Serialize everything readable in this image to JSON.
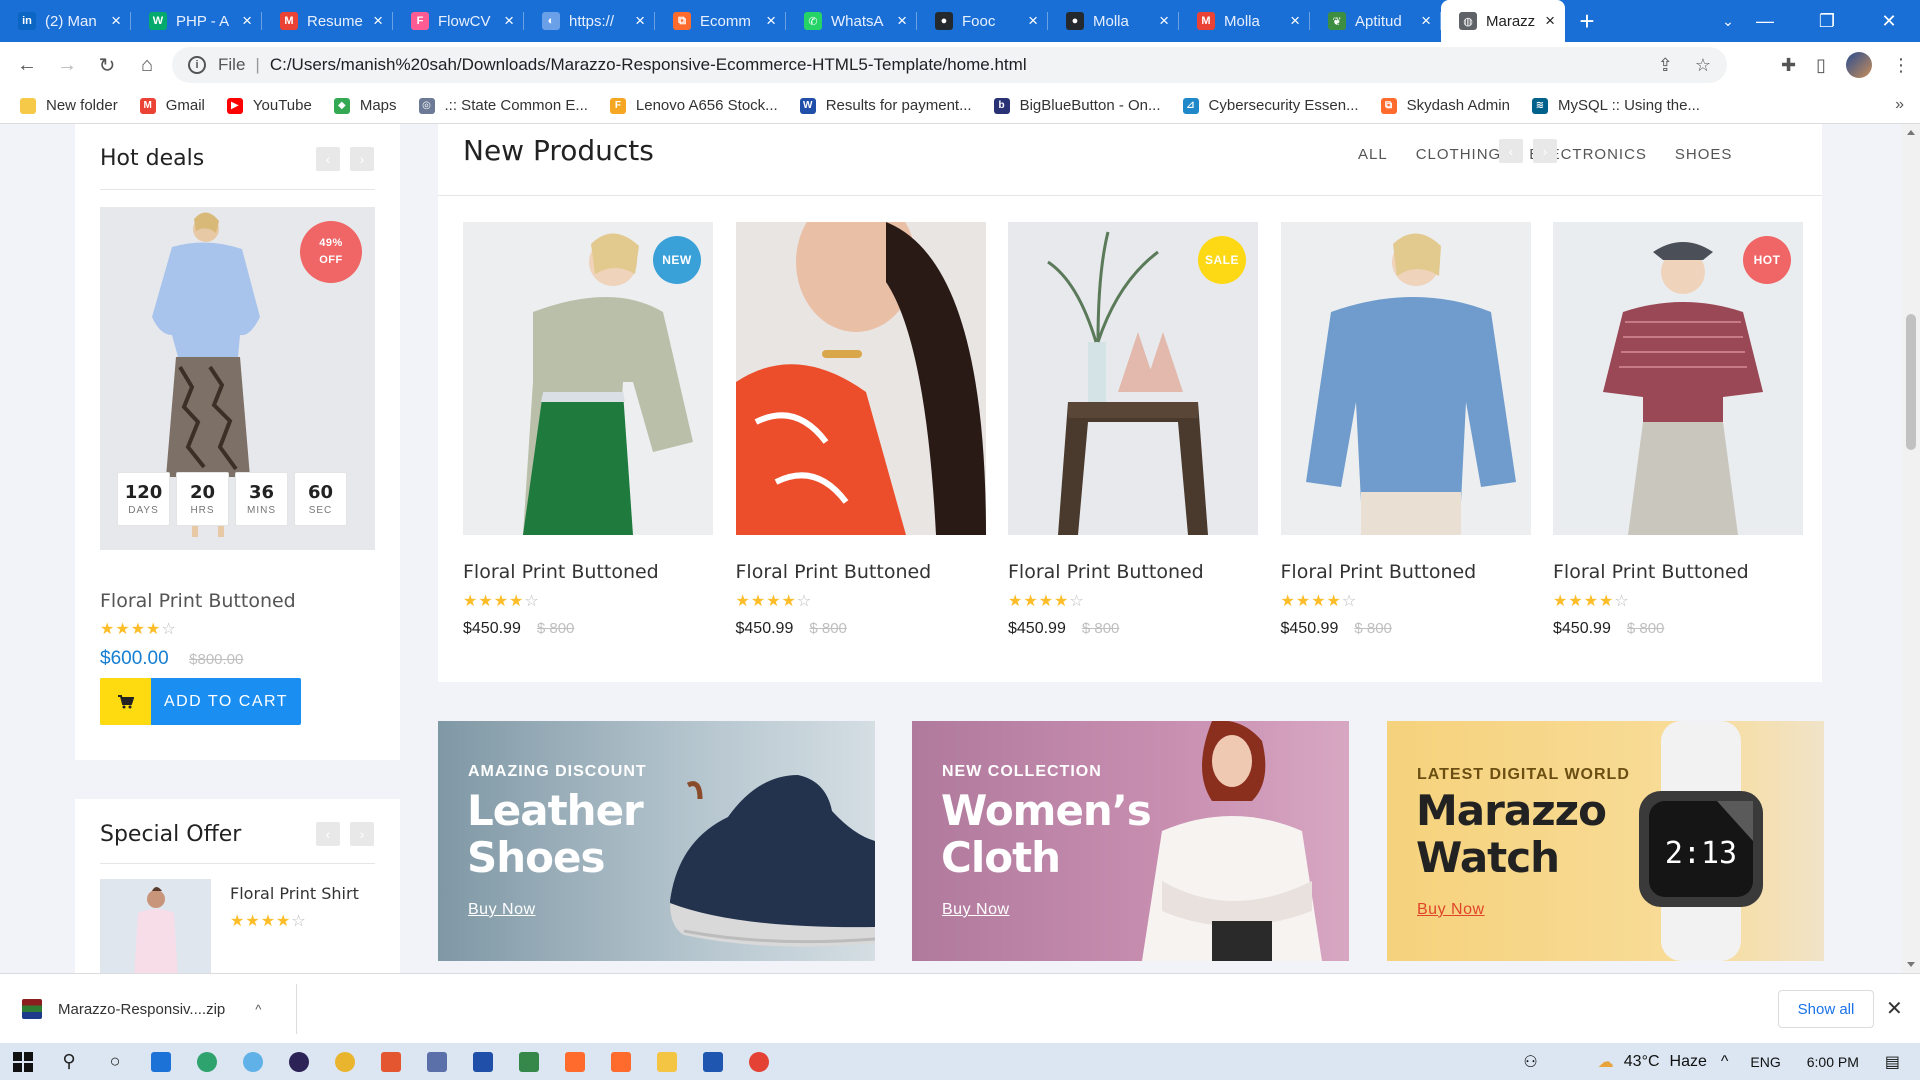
{
  "browser": {
    "tabs": [
      {
        "title": "(2) Man",
        "icon": "linkedin-icon",
        "color": "#0a66c2",
        "glyph": "in"
      },
      {
        "title": "PHP - A",
        "icon": "w3schools-icon",
        "color": "#04aa6d",
        "glyph": "W"
      },
      {
        "title": "Resume",
        "icon": "gmail-icon",
        "color": "#ea4335",
        "glyph": "M"
      },
      {
        "title": "FlowCV",
        "icon": "flowcv-icon",
        "color": "#ff5c93",
        "glyph": "F"
      },
      {
        "title": "https://",
        "icon": "globe-icon",
        "color": "#6aa0e8",
        "glyph": "◐"
      },
      {
        "title": "Ecomm",
        "icon": "app-icon",
        "color": "#ff6b2c",
        "glyph": "⧉"
      },
      {
        "title": "WhatsA",
        "icon": "whatsapp-icon",
        "color": "#25d366",
        "glyph": "✆"
      },
      {
        "title": "Fooc",
        "icon": "github-icon",
        "color": "#24292e",
        "glyph": "●"
      },
      {
        "title": "Molla",
        "icon": "github-icon",
        "color": "#24292e",
        "glyph": "●"
      },
      {
        "title": "Molla",
        "icon": "gmail-icon",
        "color": "#ea4335",
        "glyph": "M"
      },
      {
        "title": "Aptitud",
        "icon": "indiabix-icon",
        "color": "#3e8e41",
        "glyph": "❦"
      },
      {
        "title": "Marazz",
        "icon": "globe-icon",
        "color": "#5f6368",
        "glyph": "◍"
      }
    ],
    "url_scheme": "File",
    "url": "C:/Users/manish%20sah/Downloads/Marazzo-Responsive-Ecommerce-HTML5-Template/home.html",
    "bookmarks": [
      {
        "label": "New folder",
        "icon": "folder-icon",
        "color": "#f7c948",
        "glyph": ""
      },
      {
        "label": "Gmail",
        "icon": "gmail-icon",
        "color": "#ea4335",
        "glyph": "M"
      },
      {
        "label": "YouTube",
        "icon": "youtube-icon",
        "color": "#ff0000",
        "glyph": "▶"
      },
      {
        "label": "Maps",
        "icon": "maps-icon",
        "color": "#34a853",
        "glyph": "◆"
      },
      {
        "label": ".:: State Common E...",
        "icon": "globe-icon",
        "color": "#6c7a96",
        "glyph": "◎"
      },
      {
        "label": "Lenovo A656 Stock...",
        "icon": "f-icon",
        "color": "#f5a623",
        "glyph": "F"
      },
      {
        "label": "Results for payment...",
        "icon": "word-icon",
        "color": "#1f4fa8",
        "glyph": "W"
      },
      {
        "label": "BigBlueButton - On...",
        "icon": "bigbluebutton-icon",
        "color": "#283274",
        "glyph": "b"
      },
      {
        "label": "Cybersecurity Essen...",
        "icon": "cisco-icon",
        "color": "#1e88c9",
        "glyph": "⊿"
      },
      {
        "label": "Skydash Admin",
        "icon": "app-icon",
        "color": "#ff6b2c",
        "glyph": "⧉"
      },
      {
        "label": "MySQL :: Using the...",
        "icon": "mysql-icon",
        "color": "#00618a",
        "glyph": "≋"
      }
    ]
  },
  "sidebar": {
    "hot_deals": {
      "title": "Hot deals",
      "badge_pct": "49%",
      "badge_off": "OFF",
      "countdown": [
        {
          "value": "120",
          "unit": "DAYS"
        },
        {
          "value": "20",
          "unit": "HRS"
        },
        {
          "value": "36",
          "unit": "MINS"
        },
        {
          "value": "60",
          "unit": "SEC"
        }
      ],
      "product_name": "Floral Print Buttoned",
      "rating": 4,
      "price": "$600.00",
      "old_price": "$800.00",
      "cart_label": "ADD TO CART"
    },
    "special_offer": {
      "title": "Special Offer",
      "product_name": "Floral Print Shirt",
      "rating": 4
    }
  },
  "new_products": {
    "title": "New Products",
    "filters": [
      "ALL",
      "CLOTHING",
      "ELECTRONICS",
      "SHOES"
    ],
    "items": [
      {
        "name": "Floral Print Buttoned",
        "rating": 4,
        "price": "$450.99",
        "old_price": "$ 800",
        "badge": "NEW",
        "badge_color": "#3aa0d8"
      },
      {
        "name": "Floral Print Buttoned",
        "rating": 4,
        "price": "$450.99",
        "old_price": "$ 800",
        "badge": "",
        "badge_color": ""
      },
      {
        "name": "Floral Print Buttoned",
        "rating": 4,
        "price": "$450.99",
        "old_price": "$ 800",
        "badge": "SALE",
        "badge_color": "#fdd814"
      },
      {
        "name": "Floral Print Buttoned",
        "rating": 4,
        "price": "$450.99",
        "old_price": "$ 800",
        "badge": "",
        "badge_color": ""
      },
      {
        "name": "Floral Print Buttoned",
        "rating": 4,
        "price": "$450.99",
        "old_price": "$ 800",
        "badge": "HOT",
        "badge_color": "#f06565"
      }
    ]
  },
  "banners": [
    {
      "subtitle": "AMAZING DISCOUNT",
      "line1": "Leather",
      "line2": "Shoes",
      "cta": "Buy Now"
    },
    {
      "subtitle": "NEW COLLECTION",
      "line1": "Women’s",
      "line2": "Cloth",
      "cta": "Buy Now"
    },
    {
      "subtitle": "LATEST DIGITAL WORLD",
      "line1": "Marazzo",
      "line2": "Watch",
      "cta": "Buy Now",
      "watch_time": "2:13"
    }
  ],
  "downloads": {
    "file": "Marazzo-Responsiv....zip",
    "show_all": "Show all"
  },
  "taskbar": {
    "temperature": "43°C",
    "weather": "Haze",
    "language": "ENG",
    "time": "6:00 PM"
  },
  "colors": {
    "chrome_blue": "#1a6fd6",
    "accent_blue": "#1b8ef2",
    "price_blue": "#157ed2",
    "star": "#fdbd28",
    "cart_yellow": "#fddb10"
  }
}
